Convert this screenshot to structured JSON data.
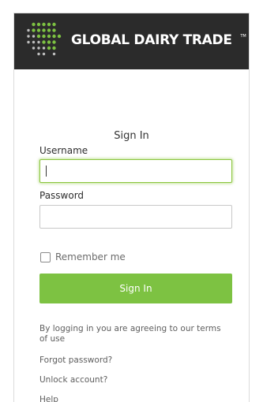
{
  "brand": {
    "name": "GLOBAL DAIRY TRADE",
    "mark": "TM"
  },
  "form": {
    "title": "Sign In",
    "username_label": "Username",
    "username_value": "",
    "password_label": "Password",
    "password_value": "",
    "remember_label": "Remember me",
    "remember_checked": false,
    "submit_label": "Sign In"
  },
  "footer": {
    "terms_text": "By logging in you are agreeing to our terms of use",
    "forgot_password": "Forgot password?",
    "unlock_account": "Unlock account?",
    "help": "Help"
  },
  "colors": {
    "header_bg": "#2b2b2b",
    "accent_green": "#7dc242",
    "focus_green": "#8cc63f"
  },
  "icons": {
    "logo": "dot-grid-logo-icon",
    "checkbox": "checkbox-icon"
  }
}
